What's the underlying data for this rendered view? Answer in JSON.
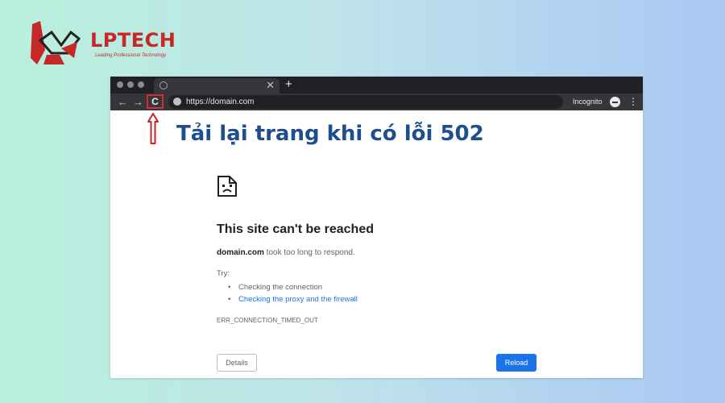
{
  "logo": {
    "brand": "LPTECH",
    "tagline": "Leading Professional Technology",
    "color": "#c62828"
  },
  "browser": {
    "tab": {
      "icon": "globe-icon",
      "close": "✕"
    },
    "new_tab": "+",
    "nav": {
      "back": "←",
      "forward": "→",
      "reload": "C"
    },
    "url": "https://domain.com",
    "incognito_label": "Incognito",
    "menu": "⋮"
  },
  "annotation": {
    "headline": "Tải lại trang khi có lỗi 502",
    "color": "#1f4e8c",
    "arrow_color": "#c62828"
  },
  "error_page": {
    "title": "This site can't be reached",
    "domain": "domain.com",
    "message_suffix": " took too long to respond.",
    "try_label": "Try:",
    "suggestions": [
      "Checking the connection",
      "Checking the proxy and the firewall"
    ],
    "error_code": "ERR_CONNECTION_TIMED_OUT",
    "details_label": "Details",
    "reload_label": "Reload",
    "reload_color": "#1a73e8"
  }
}
